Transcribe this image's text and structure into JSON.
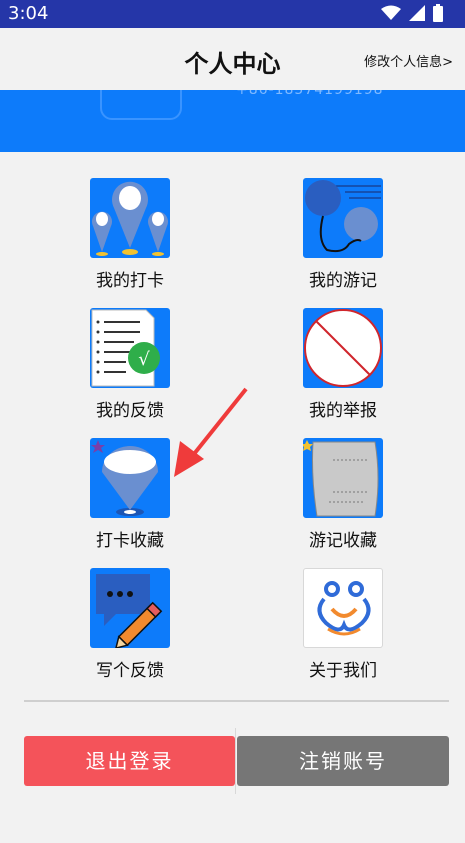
{
  "status_bar": {
    "time": "3:04"
  },
  "header": {
    "title": "个人中心",
    "edit_link": "修改个人信息>"
  },
  "profile": {
    "phone": "+86-18574199198"
  },
  "menu": [
    {
      "label": "我的打卡",
      "icon": "map-pins-icon"
    },
    {
      "label": "我的游记",
      "icon": "balloons-icon"
    },
    {
      "label": "我的反馈",
      "icon": "checklist-icon"
    },
    {
      "label": "我的举报",
      "icon": "prohibited-icon"
    },
    {
      "label": "打卡收藏",
      "icon": "location-pin-icon"
    },
    {
      "label": "游记收藏",
      "icon": "scroll-icon"
    },
    {
      "label": "写个反馈",
      "icon": "chat-pencil-icon"
    },
    {
      "label": "关于我们",
      "icon": "couple-logo-icon"
    }
  ],
  "buttons": {
    "logout": "退出登录",
    "deactivate": "注销账号"
  },
  "colors": {
    "accent": "#0d7bfa",
    "logout": "#f4535a",
    "deactivate": "#767676",
    "status_bar": "#2536a8"
  }
}
